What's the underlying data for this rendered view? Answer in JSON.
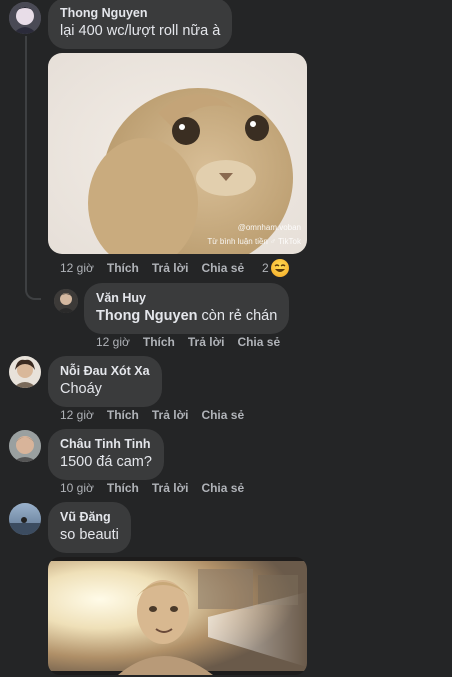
{
  "comments": [
    {
      "author": "Thong Nguyen",
      "text": "lại 400 wc/lượt roll nữa à",
      "media_watermark_1": "@omnham.voban",
      "media_watermark_2": "Từ bình luận tiền ♂ TikTok",
      "time": "12 giờ",
      "like": "Thích",
      "reply": "Trả lời",
      "share": "Chia sẻ",
      "reaction_count": "2",
      "reaction_icon": "laughing-emoji"
    },
    {
      "author": "Văn Huy",
      "mention": "Thong Nguyen",
      "text": " còn rẻ chán",
      "time": "12 giờ",
      "like": "Thích",
      "reply": "Trả lời",
      "share": "Chia sẻ"
    },
    {
      "author": "Nỗi Đau Xót Xa",
      "text": "Choáy",
      "time": "12 giờ",
      "like": "Thích",
      "reply": "Trả lời",
      "share": "Chia sẻ"
    },
    {
      "author": "Châu Tinh Tinh",
      "text": "1500 đá cam?",
      "time": "10 giờ",
      "like": "Thích",
      "reply": "Trả lời",
      "share": "Chia sẻ"
    },
    {
      "author": "Vũ Đăng",
      "text": "so beauti"
    }
  ],
  "colors": {
    "background": "#242526",
    "bubble": "#3a3b3c",
    "text": "#e4e6eb",
    "secondary_text": "#b0b3b8"
  }
}
